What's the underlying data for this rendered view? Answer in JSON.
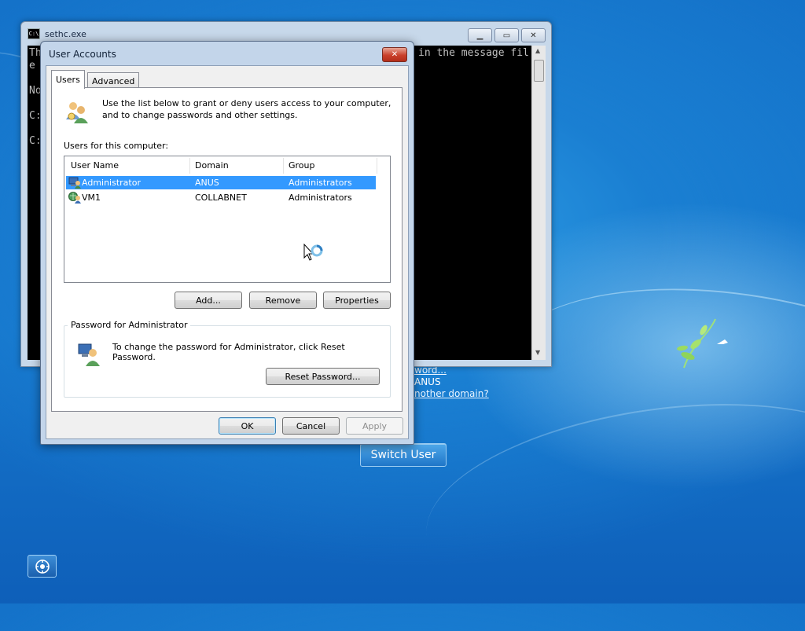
{
  "desktop": {
    "logon_link_1": "word...",
    "logon_text_domain": "ANUS",
    "logon_link_2": "nother domain?",
    "switch_user_label": "Switch User",
    "ease_access_icon": "ease-of-access-icon"
  },
  "console": {
    "title": "sethc.exe",
    "icon": "command-prompt-icon",
    "lines": [
      "Th",
      "e",
      "",
      "No",
      "",
      "C:",
      "",
      "C:"
    ],
    "right_text": "in the message fil"
  },
  "dialog": {
    "title": "User Accounts",
    "tabs": [
      {
        "label": "Users",
        "selected": true
      },
      {
        "label": "Advanced",
        "selected": false
      }
    ],
    "intro_line_1": "Use the list below to grant or deny users access to your computer,",
    "intro_line_2": "and to change passwords and other settings.",
    "users_label": "Users for this computer:",
    "columns": [
      "User Name",
      "Domain",
      "Group"
    ],
    "users": [
      {
        "name": "Administrator",
        "domain": "ANUS",
        "group": "Administrators",
        "selected": true,
        "icon": "local-user-icon"
      },
      {
        "name": "VM1",
        "domain": "COLLABNET",
        "group": "Administrators",
        "selected": false,
        "icon": "domain-user-icon"
      }
    ],
    "buttons": {
      "add": "Add...",
      "remove": "Remove",
      "properties": "Properties",
      "reset_password": "Reset Password...",
      "ok": "OK",
      "cancel": "Cancel",
      "apply": "Apply"
    },
    "password_group_label": "Password for Administrator",
    "password_text": "To change the password for Administrator, click Reset Password."
  },
  "colors": {
    "selection": "#3399ff",
    "desktop_blue": "#1677cd"
  }
}
